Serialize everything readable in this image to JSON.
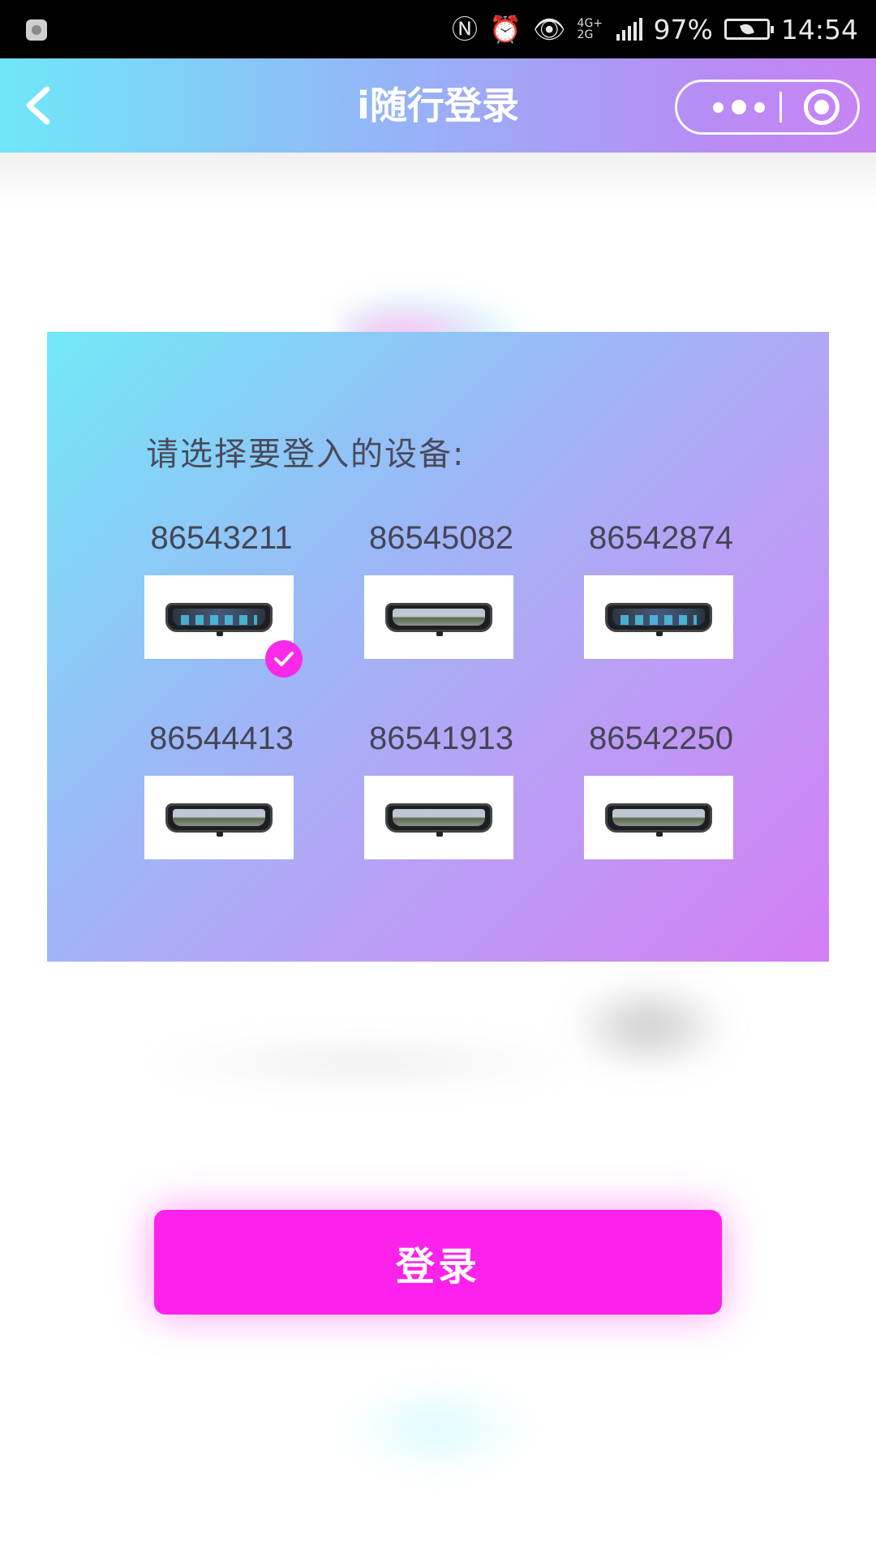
{
  "status_bar": {
    "network": "4G+ 2G",
    "battery": "97%",
    "time": "14:54"
  },
  "nav": {
    "title": "i随行登录"
  },
  "card": {
    "prompt": "请选择要登入的设备:",
    "devices": [
      {
        "id": "86543211",
        "image": "rearview-mirror-menu-screen",
        "selected": true
      },
      {
        "id": "86545082",
        "image": "rearview-mirror-road-view",
        "selected": false
      },
      {
        "id": "86542874",
        "image": "rearview-mirror-menu-screen",
        "selected": false
      },
      {
        "id": "86544413",
        "image": "rearview-mirror-road-view",
        "selected": false
      },
      {
        "id": "86541913",
        "image": "rearview-mirror-road-view",
        "selected": false
      },
      {
        "id": "86542250",
        "image": "rearview-mirror-road-view",
        "selected": false
      }
    ]
  },
  "login_button": {
    "label": "登录"
  },
  "colors": {
    "accent": "#fd21ec",
    "nav_gradient_start": "#6fe7f8",
    "nav_gradient_end": "#c883f3",
    "card_gradient_start": "#72e9f7",
    "card_gradient_end": "#d37ef3"
  },
  "icons": [
    "back-arrow-icon",
    "more-dots-icon",
    "close-target-icon",
    "check-icon",
    "nfc-icon",
    "alarm-icon",
    "eye-icon",
    "battery-icon"
  ]
}
